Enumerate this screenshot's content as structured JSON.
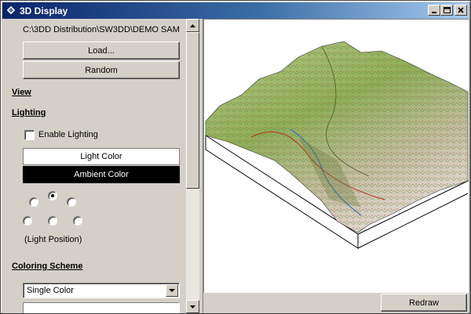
{
  "window": {
    "title": "3D Display",
    "icon": "diamond-app-icon",
    "controls": {
      "minimize": "minimize-icon",
      "maximize": "maximize-icon",
      "close": "close-icon"
    }
  },
  "panel": {
    "file_path": "C:\\3DD Distribution\\SW3DD\\DEMO SAM",
    "load_label": "Load...",
    "random_label": "Random",
    "view_heading": "View",
    "lighting_heading": "Lighting",
    "enable_lighting_label": "Enable Lighting",
    "enable_lighting_checked": false,
    "light_color_label": "Light Color",
    "light_color": "#ffffff",
    "ambient_color_label": "Ambient Color",
    "ambient_color": "#000000",
    "light_position_caption": "(Light Position)",
    "light_position_selected": "top-center",
    "coloring_heading": "Coloring Scheme",
    "coloring_value": "Single Color"
  },
  "viewer": {
    "redraw_label": "Redraw",
    "background": "#ffffff",
    "terrain_colors": [
      "#c8d8a0",
      "#8fae5a",
      "#d8c8b0",
      "#c04020",
      "#4a80b0"
    ]
  }
}
